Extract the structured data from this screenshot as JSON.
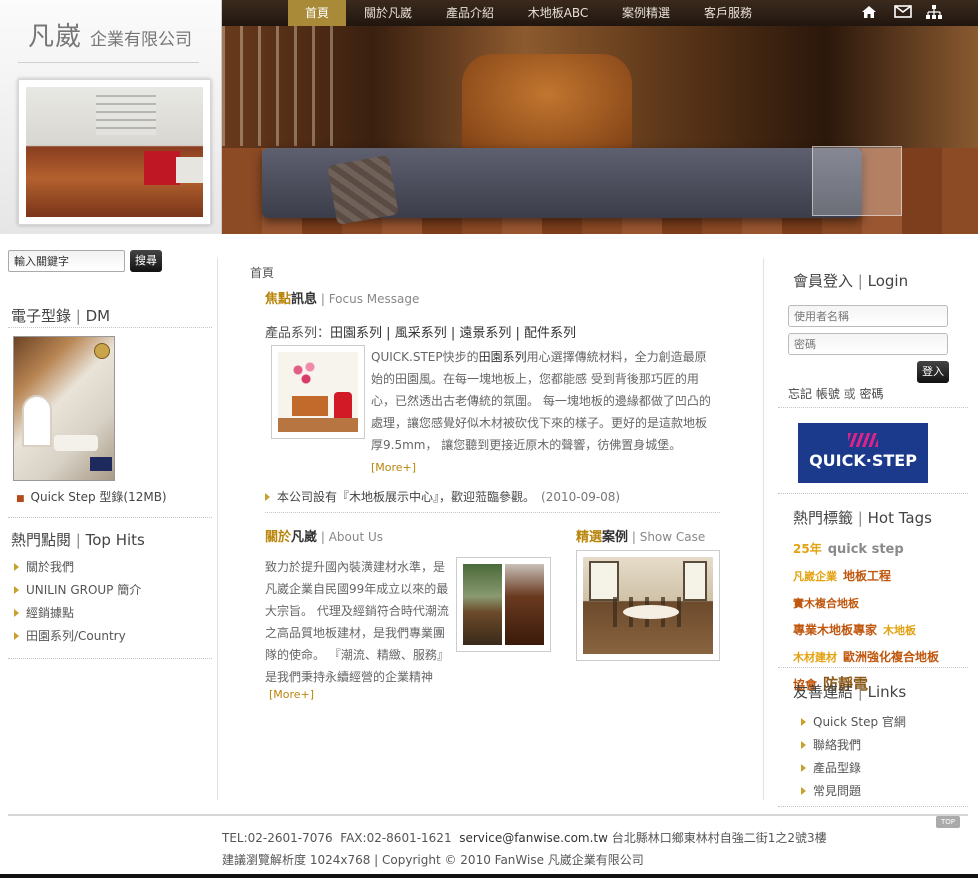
{
  "brand": {
    "name_big": "凡崴",
    "name_small": "企業有限公司"
  },
  "nav": {
    "items": [
      {
        "label": "首頁",
        "active": true
      },
      {
        "label": "關於凡崴",
        "active": false
      },
      {
        "label": "產品介紹",
        "active": false
      },
      {
        "label": "木地板ABC",
        "active": false
      },
      {
        "label": "案例精選",
        "active": false
      },
      {
        "label": "客戶服務",
        "active": false
      }
    ],
    "icons": [
      "home-icon",
      "mail-icon",
      "sitemap-icon"
    ],
    "colors": {
      "bar": "#2b1e14",
      "active": "#a88a38"
    }
  },
  "search": {
    "placeholder": "輸入關鍵字",
    "button": "搜尋"
  },
  "dm": {
    "title": "電子型錄",
    "title_en": "DM",
    "link": "Quick Step 型錄(12MB)"
  },
  "hits": {
    "title": "熱門點閱",
    "title_en": "Top Hits",
    "items": [
      "關於我們",
      "UNILIN GROUP 簡介",
      "經銷據點",
      "田園系列/Country"
    ]
  },
  "breadcrumb": "首頁",
  "focus": {
    "title_accent": "焦點",
    "title_main": "訊息",
    "title_sub": "Focus Message",
    "series_label": "產品系列：",
    "series": [
      "田園系列",
      "風采系列",
      "遠景系列",
      "配件系列"
    ],
    "text_lead": "QUICK.STEP快步的",
    "text_em": "田園系列",
    "text_rest": "用心選擇傳統材料，全力創造最原始的田園風。在每一塊地板上，您都能感 受到背後那巧匠的用心，已然透出古老傳統的氛圍。 每一塊地板的邊緣都做了凹凸的處理，讓您感覺好似木材被砍伐下來的樣子。更好的是這款地板厚9.5mm， 讓您聽到更接近原木的聲響，彷佛置身城堡。",
    "more": "[More+]"
  },
  "news": {
    "text": "本公司設有『木地板展示中心』，歡迎蒞臨參觀。",
    "date": "(2010-09-08)"
  },
  "about": {
    "title_accent": "關於",
    "title_main": "凡崴",
    "title_sub": "About Us",
    "text": "致力於提升國內裝潢建材水準，是凡崴企業自民國99年成立以來的最大宗旨。 代理及經銷符合時代潮流之高品質地板建材，是我們專業團隊的使命。 『潮流、精緻、服務』是我們秉持永續經營的企業精神",
    "more": "[More+]"
  },
  "cases": {
    "title_accent": "精選",
    "title_main": "案例",
    "title_sub": "Show Case"
  },
  "login": {
    "title": "會員登入",
    "title_en": "Login",
    "username_placeholder": "使用者名稱",
    "password_placeholder": "密碼",
    "button": "登入",
    "forgot_account": "忘記 帳號",
    "or": "或",
    "forgot_password": "密碼"
  },
  "partner": {
    "logo_text": "QUICK·STEP"
  },
  "tags": {
    "title": "熱門標籤",
    "title_en": "Hot Tags",
    "items": [
      {
        "text": "25年",
        "color": "#e3a20f",
        "size": 12
      },
      {
        "text": "quick step",
        "color": "#8a8a8a",
        "size": 13
      },
      {
        "text": "凡崴企業",
        "color": "#e3a20f",
        "size": 11
      },
      {
        "text": "地板工程",
        "color": "#c0570f",
        "size": 12
      },
      {
        "text": "實木複合地板",
        "color": "#c0570f",
        "size": 11
      },
      {
        "text": "專業木地板專家",
        "color": "#c0570f",
        "size": 12
      },
      {
        "text": "木地板",
        "color": "#e3a20f",
        "size": 11
      },
      {
        "text": "木材建材",
        "color": "#e3a20f",
        "size": 11
      },
      {
        "text": "歐洲強化複合地板",
        "color": "#c0570f",
        "size": 12
      },
      {
        "text": "協會",
        "color": "#c0570f",
        "size": 12
      },
      {
        "text": "防靜電",
        "color": "#8a5a1a",
        "size": 15
      }
    ]
  },
  "links": {
    "title": "友善連結",
    "title_en": "Links",
    "items": [
      "Quick Step 官網",
      "聯絡我們",
      "產品型錄",
      "常見問題"
    ]
  },
  "footer": {
    "tel": "TEL:02-2601-7076",
    "fax": "FAX:02-8601-1621",
    "email": "service@fanwise.com.tw",
    "address": "台北縣林口鄉東林村自強二街1之2號3樓",
    "line2": "建議瀏覽解析度 1024x768 | Copyright © 2010 FanWise 凡崴企業有限公司",
    "top": "TOP"
  }
}
